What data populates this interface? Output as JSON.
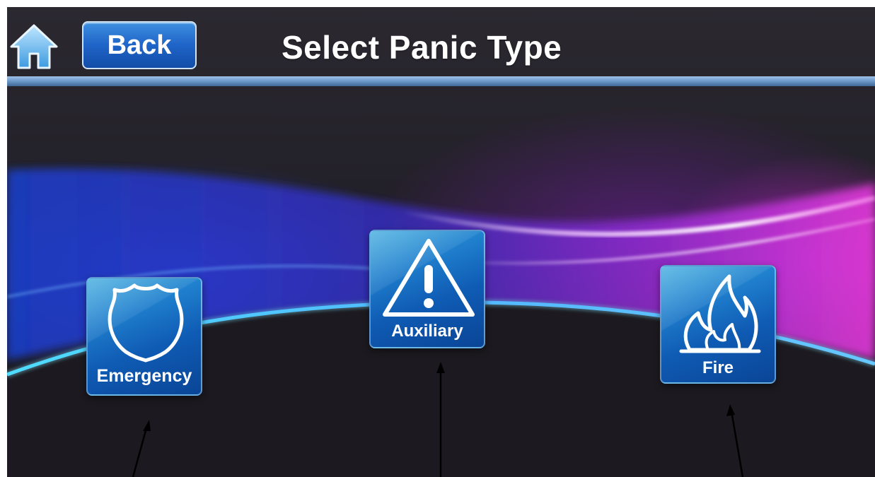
{
  "header": {
    "title": "Select Panic Type",
    "home_icon": "home-icon",
    "back_label": "Back"
  },
  "panic_types": [
    {
      "label": "Emergency",
      "icon": "shield-icon"
    },
    {
      "label": "Auxiliary",
      "icon": "warning-triangle-icon"
    },
    {
      "label": "Fire",
      "icon": "flame-icon"
    }
  ],
  "colors": {
    "accent_blue": "#1f64c8",
    "divider": "#6f9ccc",
    "wave_blue": "#3aa8ff",
    "wave_magenta": "#e040d8",
    "text": "#ffffff"
  }
}
